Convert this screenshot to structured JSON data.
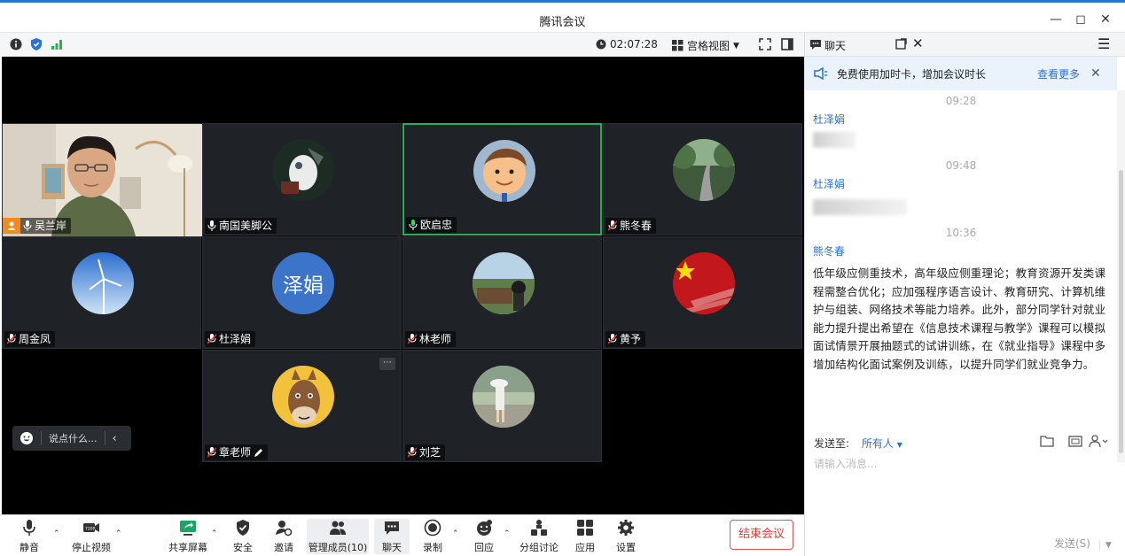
{
  "window": {
    "title": "腾讯会议",
    "minimize_icon": "minimize-icon",
    "maximize_icon": "maximize-icon",
    "close_icon": "close-icon"
  },
  "topbar": {
    "timer": "02:07:28",
    "view_mode": "宫格视图"
  },
  "participants": [
    {
      "name": "吴兰岸",
      "avatar": "camera",
      "host": true
    },
    {
      "name": "南国美脚公",
      "avatar": "photo"
    },
    {
      "name": "欧启忠",
      "avatar": "cartoon",
      "active": true
    },
    {
      "name": "熊冬春",
      "avatar": "photo"
    },
    {
      "name": "周金凤",
      "avatar": "photo"
    },
    {
      "name": "杜泽娟",
      "avatar": "text",
      "avatar_text": "泽娟"
    },
    {
      "name": "林老师",
      "avatar": "photo"
    },
    {
      "name": "黄予",
      "avatar": "photo"
    },
    {
      "name": "章老师",
      "avatar": "cartoon"
    },
    {
      "name": "刘芝",
      "avatar": "photo"
    }
  ],
  "chat_bubble_placeholder": "说点什么...",
  "toolbar": {
    "mute": "静音",
    "stop_video": "停止视频",
    "share_screen": "共享屏幕",
    "security": "安全",
    "invite": "邀请",
    "manage_members": "管理成员(10)",
    "chat": "聊天",
    "record": "录制",
    "reaction": "回应",
    "breakout": "分组讨论",
    "apps": "应用",
    "settings": "设置",
    "end_meeting": "结束会议"
  },
  "chat_panel": {
    "title": "聊天",
    "notice": "免费使用加时卡，增加会议时长",
    "notice_link": "查看更多",
    "messages": [
      {
        "time": "09:28",
        "sender": "杜泽娟"
      },
      {
        "time": "09:48",
        "sender": "杜泽娟"
      },
      {
        "time": "10:36",
        "sender": "熊冬春",
        "text": "低年级应侧重技术，高年级应侧重理论；教育资源开发类课程需整合优化；应加强程序语言设计、教育研究、计算机维护与组装、网络技术等能力培养。此外，部分同学针对就业能力提升提出希望在《信息技术课程与教学》课程可以模拟面试情景开展抽题式的试讲训练，在《就业指导》课程中多增加结构化面试案例及训练，以提升同学们就业竞争力。"
      }
    ],
    "send_to_label": "发送至:",
    "send_to_value": "所有人",
    "input_placeholder": "请输入消息...",
    "send_button": "发送(S)"
  },
  "colors": {
    "accent": "#2f6fcf",
    "active_border": "#22b05a",
    "end_red": "#e03b3b"
  }
}
